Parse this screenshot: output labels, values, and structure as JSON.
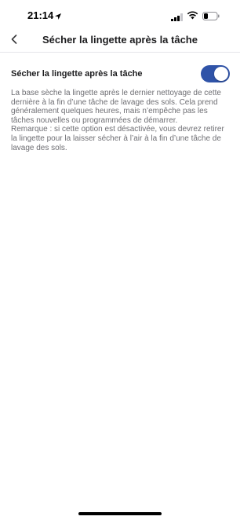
{
  "status_bar": {
    "time": "21:14",
    "icons": [
      "location-arrow-icon",
      "cellular-signal-icon",
      "wifi-icon",
      "battery-icon"
    ]
  },
  "nav": {
    "back_icon": "chevron-left-icon",
    "title": "Sécher la lingette après la tâche"
  },
  "setting": {
    "label": "Sécher la lingette après la tâche",
    "enabled": true,
    "toggle_color": "#2f53a8",
    "description": "La base sèche la lingette après le dernier nettoyage de cette dernière à la fin d’une tâche de lavage des sols. Cela prend généralement quelques heures, mais n’empêche pas les tâches nouvelles ou programmées de démarrer.",
    "note": "Remarque : si cette option est désactivée, vous devrez retirer la lingette pour la laisser sécher à l’air à la fin d’une tâche de lavage des sols."
  }
}
